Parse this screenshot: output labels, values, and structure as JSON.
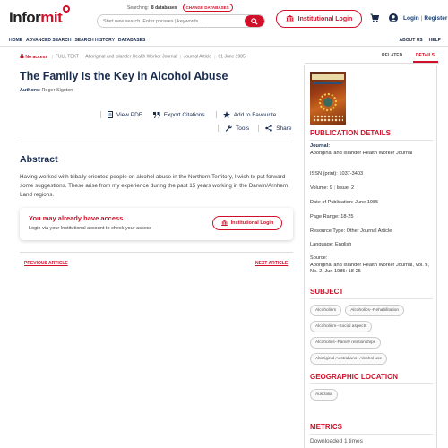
{
  "header": {
    "logo": {
      "part1": "Infor",
      "part2": "mit"
    },
    "searching_label": "Searching:",
    "databases_count": "8 databases",
    "change_databases": "CHANGE DATABASES",
    "search_placeholder": "Start new search. Enter phrases | keywords ...",
    "institutional_login": "Institutional Login",
    "login": "Login",
    "register": "Register",
    "login_sep": "|"
  },
  "nav": {
    "left": [
      "HOME",
      "ADVANCED SEARCH",
      "SEARCH HISTORY",
      "DATABASES"
    ],
    "right": [
      "ABOUT US",
      "HELP"
    ]
  },
  "article": {
    "no_access": "No access",
    "format": "FULL TEXT",
    "journal": "Aboriginal and Islander Health Worker Journal",
    "type": "Journal Article",
    "date": "01 June 1985",
    "title": "The Family Is the Key in Alcohol Abuse",
    "authors_label": "Authors:",
    "authors": "Roger Sigston",
    "actions": {
      "view_pdf": "View PDF",
      "export": "Export Citations",
      "favourite": "Add to Favourite",
      "tools": "Tools",
      "share": "Share"
    },
    "abstract_heading": "Abstract",
    "abstract_text": "Having worked with tribally oriented people on alcohol abuse in the Northern Territory, I wish to put forward some suggestions. These arise from my experience during the past 15 years working in the Darwin/Arnhem Land regions.",
    "access_title": "You may already have access",
    "access_sub": "Login via your Institutional account to check your access",
    "access_button": "Institutional Login",
    "prev": "PREVIOUS ARTICLE",
    "next": "NEXT ARTICLE"
  },
  "sidebar": {
    "tabs": {
      "related": "RELATED",
      "details": "DETAILS"
    },
    "pub_heading": "PUBLICATION DETAILS",
    "journal_label": "Journal:",
    "journal_value": "Aboriginal and Islander Health Worker Journal",
    "issn_label": "ISSN (print):",
    "issn_value": "1037-3403",
    "volume_label": "Volume:",
    "volume_value": "9",
    "issue_label": "Issue:",
    "issue_value": "2",
    "date_label": "Date of Publication:",
    "date_value": "June 1985",
    "pages_label": "Page Range:",
    "pages_value": "18-25",
    "rtype_label": "Resource Type:",
    "rtype_value": "Other Journal Article",
    "lang_label": "Language:",
    "lang_value": "English",
    "source_label": "Source:",
    "source_value": "Aboriginal and Islander Health Worker Journal, Vol. 9, No. 2, Jun 1985: 18-25",
    "subject_heading": "SUBJECT",
    "subjects": [
      "Alcoholism",
      "Alcoholics--Rehabilitation",
      "Alcoholism--Social aspects",
      "Alcoholics--Family relationships",
      "Aboriginal Australians--Alcohol use"
    ],
    "geo_heading": "GEOGRAPHIC LOCATION",
    "geo": [
      "Australia"
    ],
    "metrics_heading": "METRICS",
    "metrics_text": "Downloaded 1 times"
  },
  "colors": {
    "accent": "#d0102a",
    "navy": "#1a2d4f"
  }
}
